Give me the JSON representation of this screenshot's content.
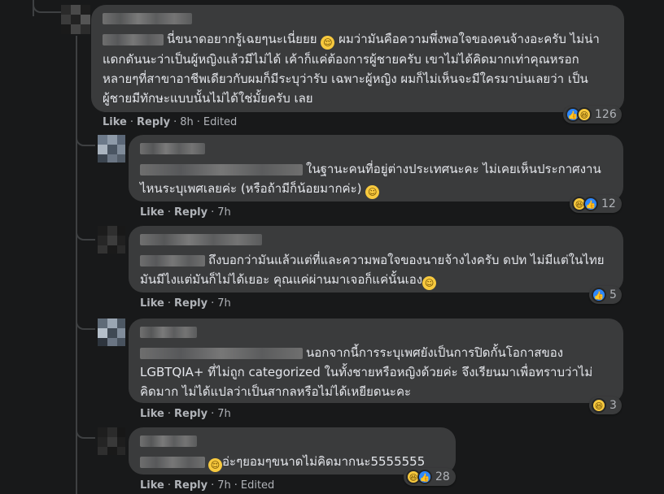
{
  "comments": [
    {
      "text_before": "นี่ขนาดอยากรู้เฉยๆนะเนี่ยยย",
      "text_after": " ผมว่ามันคือความพึ่งพอใจของคนจ้างอะครับ ไม่น่าแดกดันนะว่าเป็นผู้หญิงแล้วมีไม่ได้ เค้าก็แค่ต้องการผู้ชายครับ เขาไม่ได้คิดมากเท่าคุณหรอก หลายๆที่สาขาอาชีพเดียวกับผมก็มีระบุว่ารับ เฉพาะผู้หญิง ผมก็ไม่เห็นจะมีใครมาบ่นเลยว่า เป็นผู้ชายมีทักษะแบบนั้นไม่ได้ใช่มั้ยครับ เลย",
      "like": "Like",
      "reply": "Reply",
      "time": "8h",
      "edited": "Edited",
      "reaction_count": "126",
      "reactions": [
        "like-icon",
        "haha-icon"
      ]
    },
    {
      "text_before": "ในฐานะคนที่อยู่ต่างประเทศนะคะ ไม่เคยเห็นประกาศงานไหนระบุเพศเลยค่ะ (หรือถ้ามีก็น้อยมากค่ะ)",
      "text_after": "",
      "like": "Like",
      "reply": "Reply",
      "time": "7h",
      "reaction_count": "12",
      "reactions": [
        "haha-icon",
        "like-icon"
      ]
    },
    {
      "text_before": "ถึงบอกว่ามันแล้วแต่ที่และความพอใจของนายจ้างไงครับ ดปท ไม่มีแต่ในไทยมันมีไงแต่มันก็ไม่ได้เยอะ คุณแค่ผ่านมาเจอก็แค่นั้นเอง",
      "text_after": "",
      "like": "Like",
      "reply": "Reply",
      "time": "7h",
      "reaction_count": "5",
      "reactions": [
        "like-icon"
      ]
    },
    {
      "text_before": "นอกจากนี้การระบุเพศยังเป็นการปิดกั้นโอกาสของ LGBTQIA+ ที่ไม่ถูก categorized ในทั้งชายหรือหญิงด้วยค่ะ จึงเรียนมาเพื่อทราบว่าไม่คิดมาก ไม่ได้แปลว่าเป็นสากลหรือไม่ได้เหยียดนะคะ",
      "text_after": "",
      "like": "Like",
      "reply": "Reply",
      "time": "7h",
      "reaction_count": "3",
      "reactions": [
        "haha-icon"
      ]
    },
    {
      "text_before": "อ่ะๆยอมๆขนาดไม่คิดมากนะ5555555",
      "text_after": "",
      "like": "Like",
      "reply": "Reply",
      "time": "7h",
      "edited": "Edited",
      "reaction_count": "28",
      "reactions": [
        "haha-icon",
        "like-icon"
      ]
    }
  ],
  "colors": {
    "background": "#18191a",
    "bubble": "#3a3b3c",
    "text": "#e4e6eb",
    "muted": "#b0b3b8",
    "like": "#2d88ff",
    "haha": "#f7c93e"
  }
}
